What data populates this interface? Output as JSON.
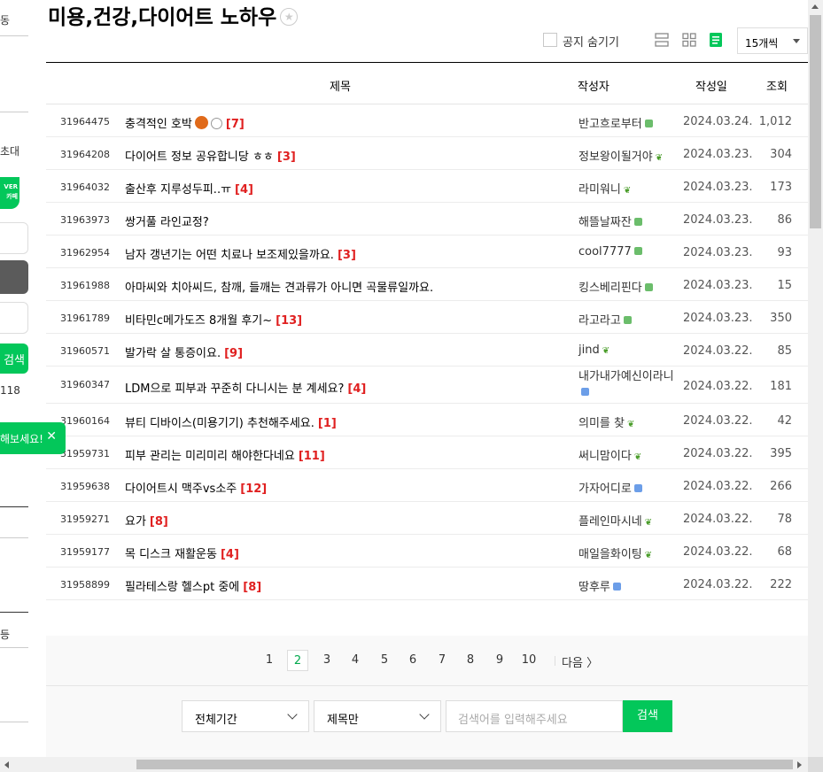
{
  "cafe_title": "미용,건강,다이어트 노하우",
  "sidebar_fragments": {
    "top": "동",
    "invite": "초대",
    "naver_badge": "VER\n카페",
    "search_btn": "검색",
    "count": "118",
    "toast": "해보세요!"
  },
  "toolbar": {
    "hide_notice_label": "공지 숨기기",
    "per_page": "15개씩"
  },
  "columns": {
    "subject": "제목",
    "author": "작성자",
    "date": "작성일",
    "views": "조회"
  },
  "posts": [
    {
      "num": "31964475",
      "subject": "충격적인 호박",
      "comments": "[7]",
      "author": "반고흐로부터",
      "date": "2024.03.24.",
      "views": "1,012"
    },
    {
      "num": "31964208",
      "subject": "다이어트 정보 공유합니당 ㅎㅎ",
      "comments": "[3]",
      "author": "정보왕이될거야",
      "date": "2024.03.23.",
      "views": "304"
    },
    {
      "num": "31964032",
      "subject": "출산후 지루성두피..ㅠ",
      "comments": "[4]",
      "author": "라미워니",
      "date": "2024.03.23.",
      "views": "173"
    },
    {
      "num": "31963973",
      "subject": "쌍거풀 라인교정?",
      "comments": "",
      "author": "해뜰날짜잔",
      "date": "2024.03.23.",
      "views": "86"
    },
    {
      "num": "31962954",
      "subject": "남자 갱년기는 어떤 치료나 보조제있을까요.",
      "comments": "[3]",
      "author": "cool7777",
      "date": "2024.03.23.",
      "views": "93"
    },
    {
      "num": "31961988",
      "subject": "아마씨와 치아씨드, 참깨, 들깨는 견과류가 아니면 곡물류일까요.",
      "comments": "",
      "author": "킹스베리핀다",
      "date": "2024.03.23.",
      "views": "15"
    },
    {
      "num": "31961789",
      "subject": "비타민c메가도즈 8개월 후기~",
      "comments": "[13]",
      "author": "라고라고",
      "date": "2024.03.23.",
      "views": "350"
    },
    {
      "num": "31960571",
      "subject": "발가락 살 통증이요.",
      "comments": "[9]",
      "author": "jind",
      "date": "2024.03.22.",
      "views": "85"
    },
    {
      "num": "31960347",
      "subject": "LDM으로 피부과 꾸준히 다니시는 분 계세요?",
      "comments": "[4]",
      "author": "내가내가예신이라니",
      "date": "2024.03.22.",
      "views": "181"
    },
    {
      "num": "31960164",
      "subject": "뷰티 디바이스(미용기기) 추천해주세요.",
      "comments": "[1]",
      "author": "의미를 찾",
      "date": "2024.03.22.",
      "views": "42"
    },
    {
      "num": "31959731",
      "subject": "피부 관리는 미리미리 해야한다네요",
      "comments": "[11]",
      "author": "써니맘이다",
      "date": "2024.03.22.",
      "views": "395"
    },
    {
      "num": "31959638",
      "subject": "다이어트시 맥주vs소주",
      "comments": "[12]",
      "author": "가자어디로",
      "date": "2024.03.22.",
      "views": "266"
    },
    {
      "num": "31959271",
      "subject": "요가",
      "comments": "[8]",
      "author": "플레인마시네",
      "date": "2024.03.22.",
      "views": "78"
    },
    {
      "num": "31959177",
      "subject": "목 디스크 재활운동",
      "comments": "[4]",
      "author": "매일을화이팅",
      "date": "2024.03.22.",
      "views": "68"
    },
    {
      "num": "31958899",
      "subject": "필라테스랑 헬스pt 중에",
      "comments": "[8]",
      "author": "땅후루",
      "date": "2024.03.22.",
      "views": "222"
    }
  ],
  "pagination": {
    "pages": [
      "1",
      "2",
      "3",
      "4",
      "5",
      "6",
      "7",
      "8",
      "9",
      "10"
    ],
    "current": "2",
    "next": "다음"
  },
  "search": {
    "period": "전체기간",
    "scope": "제목만",
    "placeholder": "검색어를 입력해주세요",
    "button": "검색"
  },
  "colors": {
    "accent": "#03c75a",
    "comment": "#e02020"
  }
}
